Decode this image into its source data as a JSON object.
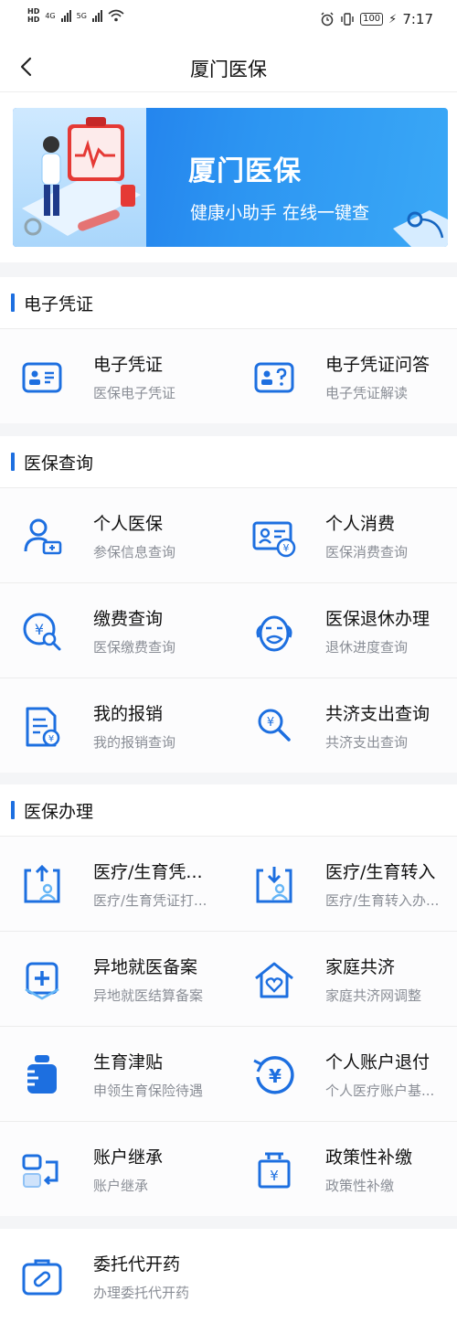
{
  "status": {
    "net": "4G",
    "net2": "5G",
    "battery": "100",
    "time": "7:17"
  },
  "nav": {
    "title": "厦门医保"
  },
  "banner": {
    "title": "厦门医保",
    "subtitle": "健康小助手 在线一键查"
  },
  "sections": [
    {
      "title": "电子凭证",
      "items": [
        {
          "title": "电子凭证",
          "sub": "医保电子凭证",
          "icon": "id-card-icon"
        },
        {
          "title": "电子凭证问答",
          "sub": "电子凭证解读",
          "icon": "id-card-question-icon"
        }
      ]
    },
    {
      "title": "医保查询",
      "items": [
        {
          "title": "个人医保",
          "sub": "参保信息查询",
          "icon": "person-card-icon"
        },
        {
          "title": "个人消费",
          "sub": "医保消费查询",
          "icon": "consumption-card-icon"
        },
        {
          "title": "缴费查询",
          "sub": "医保缴费查询",
          "icon": "yuan-search-icon"
        },
        {
          "title": "医保退休办理",
          "sub": "退休进度查询",
          "icon": "elder-face-icon"
        },
        {
          "title": "我的报销",
          "sub": "我的报销查询",
          "icon": "document-yuan-icon"
        },
        {
          "title": "共济支出查询",
          "sub": "共济支出查询",
          "icon": "magnifier-yuan-icon"
        }
      ]
    },
    {
      "title": "医保办理",
      "items": [
        {
          "title": "医疗/生育凭...",
          "sub": "医疗/生育凭证打...",
          "icon": "transfer-out-icon"
        },
        {
          "title": "医疗/生育转入",
          "sub": "医疗/生育转入办...",
          "icon": "transfer-in-icon"
        },
        {
          "title": "异地就医备案",
          "sub": "异地就医结算备案",
          "icon": "medical-shield-icon"
        },
        {
          "title": "家庭共济",
          "sub": "家庭共济网调整",
          "icon": "home-heart-icon"
        },
        {
          "title": "生育津贴",
          "sub": "申领生育保险待遇",
          "icon": "bottle-icon"
        },
        {
          "title": "个人账户退付",
          "sub": "个人医疗账户基...",
          "icon": "refund-yuan-icon"
        },
        {
          "title": "账户继承",
          "sub": "账户继承",
          "icon": "account-inherit-icon"
        },
        {
          "title": "政策性补缴",
          "sub": "政策性补缴",
          "icon": "policy-payment-icon"
        }
      ]
    },
    {
      "title": "",
      "items": [
        {
          "title": "委托代开药",
          "sub": "办理委托代开药",
          "icon": "medicine-kit-icon"
        }
      ]
    }
  ]
}
